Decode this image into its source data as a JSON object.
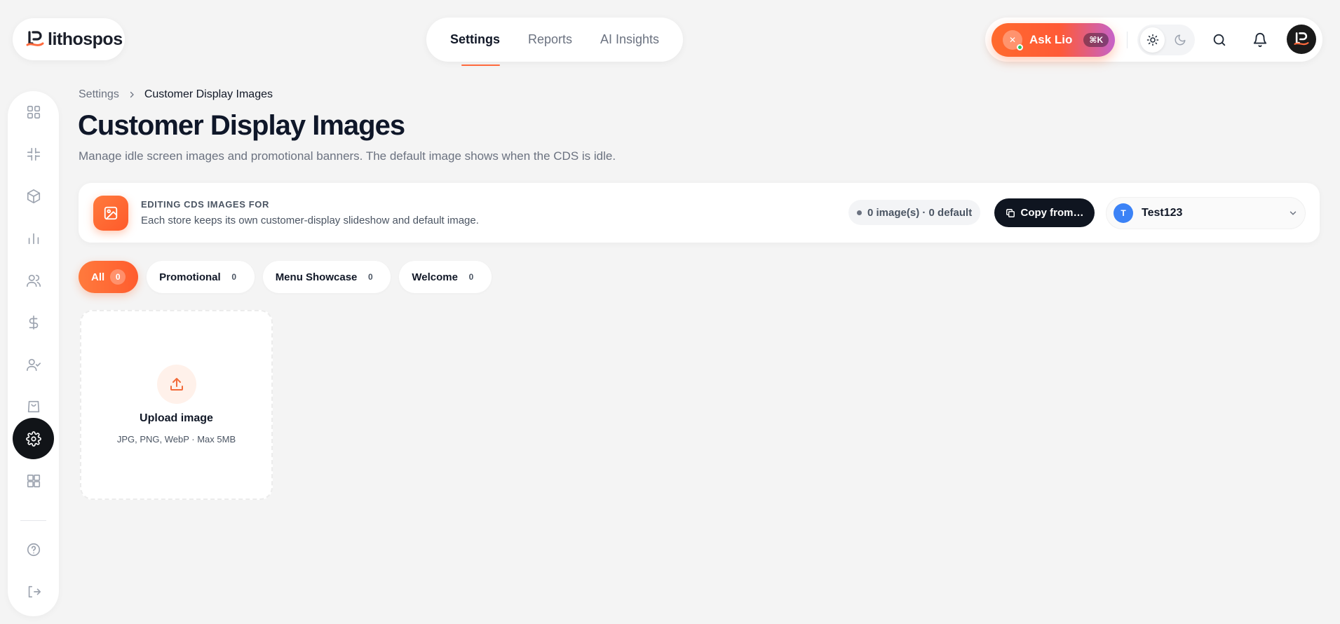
{
  "brand": {
    "name": "lithospos",
    "accent": "#ff6a3d"
  },
  "nav": {
    "tabs": [
      {
        "label": "Settings",
        "active": true
      },
      {
        "label": "Reports",
        "active": false
      },
      {
        "label": "AI Insights",
        "active": false
      }
    ]
  },
  "header": {
    "ask_label": "Ask Lio",
    "ask_shortcut": "⌘K",
    "ask_avatar_glyph": "✕",
    "theme": "light"
  },
  "sidebar": {
    "items": [
      {
        "icon": "dashboard-grid-icon",
        "active": false
      },
      {
        "icon": "hashtag-icon",
        "active": false
      },
      {
        "icon": "cube-icon",
        "active": false
      },
      {
        "icon": "bar-chart-icon",
        "active": false
      },
      {
        "icon": "users-icon",
        "active": false
      },
      {
        "icon": "dollar-icon",
        "active": false
      },
      {
        "icon": "user-check-icon",
        "active": false
      },
      {
        "icon": "shopping-bag-icon",
        "active": false
      },
      {
        "icon": "gear-icon",
        "active": true
      },
      {
        "icon": "apps-grid-icon",
        "active": false
      }
    ],
    "footer": [
      {
        "icon": "help-circle-icon"
      },
      {
        "icon": "logout-icon"
      }
    ]
  },
  "breadcrumb": {
    "parent": "Settings",
    "current": "Customer Display Images"
  },
  "page": {
    "title": "Customer Display Images",
    "subtitle": "Manage idle screen images and promotional banners. The default image shows when the CDS is idle."
  },
  "store_card": {
    "kicker": "EDITING CDS IMAGES FOR",
    "description": "Each store keeps its own customer-display slideshow and default image.",
    "count_text": "0 image(s) · 0 default",
    "copy_label": "Copy from…",
    "store_initial": "T",
    "store_name": "Test123"
  },
  "filters": [
    {
      "label": "All",
      "count": "0",
      "active": true
    },
    {
      "label": "Promotional",
      "count": "0",
      "active": false
    },
    {
      "label": "Menu Showcase",
      "count": "0",
      "active": false
    },
    {
      "label": "Welcome",
      "count": "0",
      "active": false
    }
  ],
  "upload": {
    "title": "Upload image",
    "hint": "JPG, PNG, WebP · Max 5MB"
  }
}
